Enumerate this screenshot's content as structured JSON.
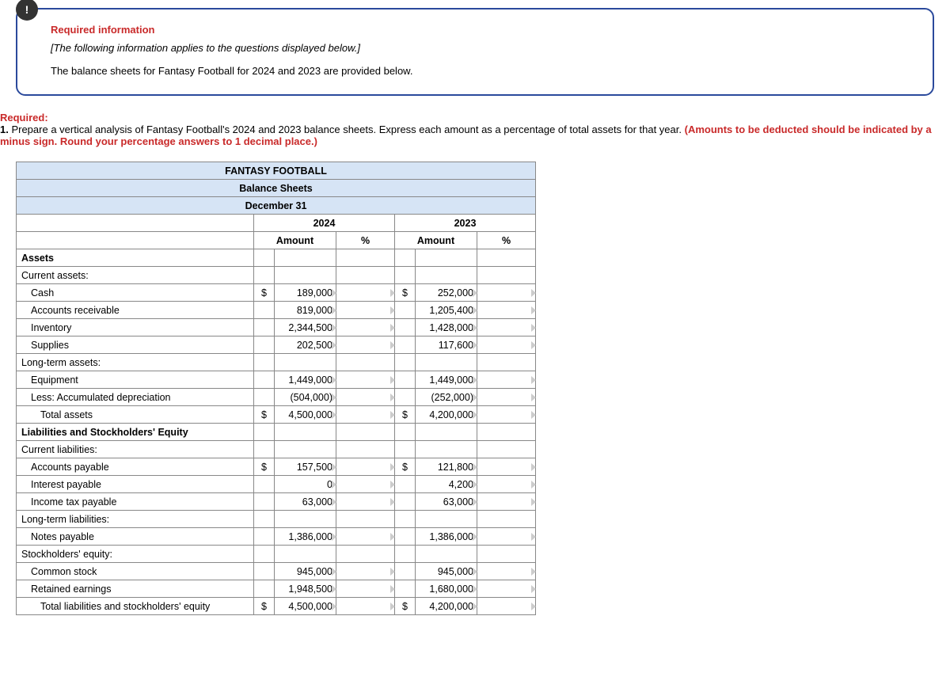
{
  "info": {
    "title": "Required information",
    "applies": "[The following information applies to the questions displayed below.]",
    "intro": "The balance sheets for Fantasy Football for 2024 and 2023 are provided below."
  },
  "required": {
    "hdr": "Required:",
    "num": "1.",
    "text": " Prepare a vertical analysis of Fantasy Football's 2024 and 2023 balance sheets. Express each amount as a percentage of total assets for that year. ",
    "note": "(Amounts to be deducted should be indicated by a minus sign. Round your percentage answers to 1 decimal place.)"
  },
  "table": {
    "company": "FANTASY FOOTBALL",
    "statement": "Balance Sheets",
    "date": "December 31",
    "year1": "2024",
    "year2": "2023",
    "amount_hdr": "Amount",
    "pct_hdr": "%",
    "sections": {
      "assets": "Assets",
      "current_assets": "Current assets:",
      "longterm_assets": "Long-term assets:",
      "liab_equity": "Liabilities and Stockholders' Equity",
      "current_liab": "Current liabilities:",
      "longterm_liab": "Long-term liabilities:",
      "equity": "Stockholders' equity:"
    },
    "rows": {
      "cash": {
        "label": "Cash",
        "d1": "$",
        "a1": "189,000",
        "d2": "$",
        "a2": "252,000"
      },
      "ar": {
        "label": "Accounts receivable",
        "a1": "819,000",
        "a2": "1,205,400"
      },
      "inv": {
        "label": "Inventory",
        "a1": "2,344,500",
        "a2": "1,428,000"
      },
      "sup": {
        "label": "Supplies",
        "a1": "202,500",
        "a2": "117,600"
      },
      "equip": {
        "label": "Equipment",
        "a1": "1,449,000",
        "a2": "1,449,000"
      },
      "accdep": {
        "label": "Less: Accumulated depreciation",
        "a1": "(504,000)",
        "a2": "(252,000)"
      },
      "ta": {
        "label": "Total assets",
        "d1": "$",
        "a1": "4,500,000",
        "d2": "$",
        "a2": "4,200,000"
      },
      "ap": {
        "label": "Accounts payable",
        "d1": "$",
        "a1": "157,500",
        "d2": "$",
        "a2": "121,800"
      },
      "ip": {
        "label": "Interest payable",
        "a1": "0",
        "a2": "4,200"
      },
      "itp": {
        "label": "Income tax payable",
        "a1": "63,000",
        "a2": "63,000"
      },
      "np": {
        "label": "Notes payable",
        "a1": "1,386,000",
        "a2": "1,386,000"
      },
      "cs": {
        "label": "Common stock",
        "a1": "945,000",
        "a2": "945,000"
      },
      "re": {
        "label": "Retained earnings",
        "a1": "1,948,500",
        "a2": "1,680,000"
      },
      "tle": {
        "label": "Total liabilities and stockholders' equity",
        "d1": "$",
        "a1": "4,500,000",
        "d2": "$",
        "a2": "4,200,000"
      }
    }
  }
}
